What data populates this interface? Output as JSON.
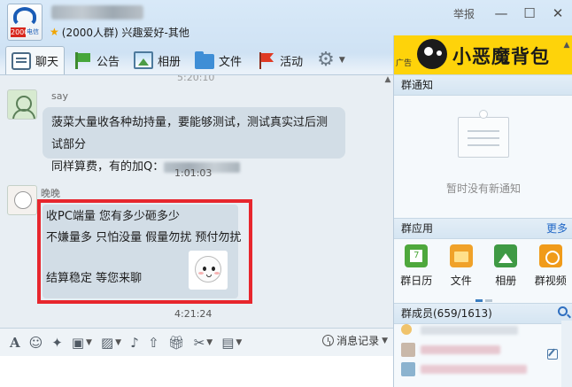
{
  "window": {
    "group_info": "(2000人群) 兴趣爱好-其他",
    "report_label": "举报",
    "logo_tag": "2000",
    "logo_tag2": "电信"
  },
  "tabs": [
    {
      "label": "聊天",
      "icon": "chat-icon",
      "active": true
    },
    {
      "label": "公告",
      "icon": "notice-flag-icon"
    },
    {
      "label": "相册",
      "icon": "album-icon"
    },
    {
      "label": "文件",
      "icon": "folder-icon"
    },
    {
      "label": "活动",
      "icon": "activity-flag-icon"
    }
  ],
  "chat": {
    "messages": [
      {
        "sender": "say",
        "lines": [
          "菠菜大量收各种劫持量，要能够测试，测试真实过后测试部分",
          "同样算费，有的加Q："
        ],
        "time": "1:01:03"
      },
      {
        "sender": "晚晚",
        "lines": [
          "收PC端量 您有多少砸多少",
          "不嫌量多 只怕没量 假量勿扰 预付勿扰",
          "结算稳定 等您来聊"
        ],
        "time": "4:21:24"
      }
    ],
    "top_time": "5:20:10"
  },
  "input_toolbar": {
    "history_label": "消息记录"
  },
  "right_panel": {
    "ad_tag": "广告",
    "ad_text": "小恶魔背包",
    "notice_title": "群通知",
    "notice_empty": "暂时没有新通知",
    "apps_title": "群应用",
    "apps_more": "更多",
    "apps": [
      {
        "label": "群日历",
        "icon": "calendar-icon"
      },
      {
        "label": "文件",
        "icon": "folder-icon"
      },
      {
        "label": "相册",
        "icon": "photo-icon"
      },
      {
        "label": "群视频",
        "icon": "video-icon"
      }
    ],
    "members_title": "群成员(659/1613)"
  },
  "colors": {
    "highlight_box": "#e7262d",
    "bubble": "#d2dde6",
    "link": "#1f66c6",
    "ad_bg": "#fed30a"
  }
}
